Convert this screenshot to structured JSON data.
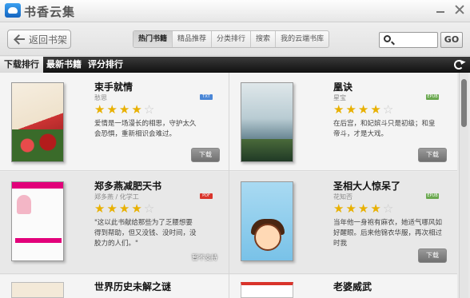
{
  "app": {
    "title": "书香云集"
  },
  "toolbar": {
    "back_label": "返回书架",
    "tabs": [
      "热门书籍",
      "精品推荐",
      "分类排行",
      "搜索",
      "我的云端书库"
    ],
    "search_placeholder": "",
    "go_label": "GO"
  },
  "subnav": {
    "tabs": [
      "下载排行",
      "最新书籍",
      "评分排行"
    ]
  },
  "books": [
    {
      "title": "束手就情",
      "author": "愁思",
      "format": "TXT",
      "format_color": "#4a86d6",
      "rating": 4,
      "desc": "爱情是一场漫长的相思，守护太久会恐惧，重新相识会难过。",
      "download_label": "下载"
    },
    {
      "title": "凰诀",
      "author": "星宝",
      "format": "EPUB",
      "format_color": "#6aa84f",
      "rating": 4,
      "desc": "在后宫，和妃嫔斗只是初级；和皇帝斗，才是大戏。",
      "download_label": "下载"
    },
    {
      "title": "郑多燕减肥天书",
      "author": "郑多燕 / 化学工",
      "format": "PDF",
      "format_color": "#d9342b",
      "rating": 4,
      "desc": "\"这以此书献给那些为了乏腰想要得到帮助，但又没钱、没时间，没胶力的人们。\"",
      "download_label": "暂不支持"
    },
    {
      "title": "圣相大人惊呆了",
      "author": "花知否",
      "format": "EPUB",
      "format_color": "#6aa84f",
      "rating": 4,
      "desc": "当年他一身袍有麻衣，她适气哪风如好醒眼。后来他锦衣华服，再次相过时我",
      "download_label": "下载"
    },
    {
      "title": "世界历史未解之谜"
    },
    {
      "title": "老婆威武"
    }
  ]
}
